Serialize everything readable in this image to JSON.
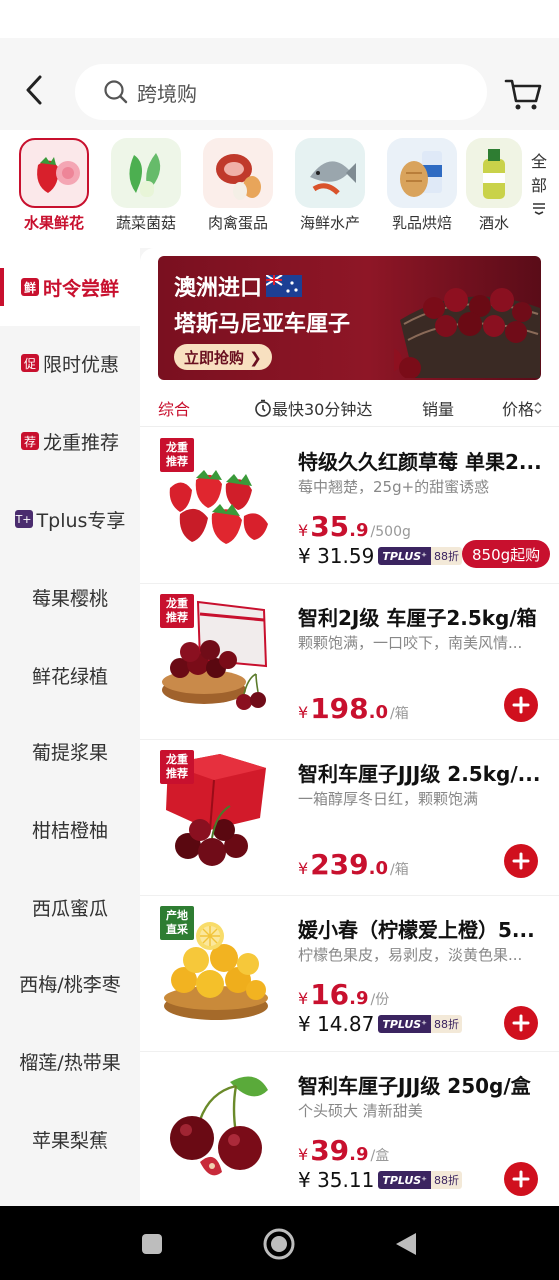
{
  "search": {
    "text": "跨境购"
  },
  "categories": [
    {
      "label": "水果鲜花",
      "icon": "strawberry-flower-image",
      "active": true
    },
    {
      "label": "蔬菜菌菇",
      "icon": "vegetable-image"
    },
    {
      "label": "肉禽蛋品",
      "icon": "meat-egg-image"
    },
    {
      "label": "海鲜水产",
      "icon": "seafood-image"
    },
    {
      "label": "乳品烘焙",
      "icon": "dairy-bakery-image"
    },
    {
      "label": "酒水",
      "icon": "drinks-image"
    }
  ],
  "all_button": {
    "line1": "全",
    "line2": "部"
  },
  "sidebar": {
    "items": [
      {
        "badge": "鲜",
        "label": "时令尝鲜",
        "active": true
      },
      {
        "badge": "促",
        "label": "限时优惠"
      },
      {
        "badge": "荐",
        "label": "龙重推荐"
      },
      {
        "badge": "T+",
        "label": "Tplus专享"
      },
      {
        "label": "莓果樱桃"
      },
      {
        "label": "鲜花绿植"
      },
      {
        "label": "葡提浆果"
      },
      {
        "label": "柑桔橙柚"
      },
      {
        "label": "西瓜蜜瓜"
      },
      {
        "label": "西梅/桃李枣"
      },
      {
        "label": "榴莲/热带果"
      },
      {
        "label": "苹果梨蕉"
      }
    ]
  },
  "banner": {
    "line1": "澳洲进口",
    "line2": "塔斯马尼亚车厘子",
    "button": "立即抢购 ❯"
  },
  "sort": {
    "comprehensive": "综合",
    "fastest": "最快30分钟达",
    "sales": "销量",
    "price": "价格"
  },
  "products": [
    {
      "tag": "龙重\n推荐",
      "title": "特级久久红颜草莓 单果2...",
      "subtitle": "莓中翘楚，25g+的甜蜜诱惑",
      "price_int": "35",
      "price_dec": ".9",
      "unit": "/500g",
      "plus_price": "¥ 31.59",
      "plus_label": "TPLUS⁺",
      "discount": "88折",
      "action": "850g起购"
    },
    {
      "tag": "龙重\n推荐",
      "title": "智利2J级 车厘子2.5kg/箱",
      "subtitle": "颗颗饱满，一口咬下，南美风情...",
      "price_int": "198",
      "price_dec": ".0",
      "unit": "/箱"
    },
    {
      "tag": "龙重\n推荐",
      "title": "智利车厘子JJJ级 2.5kg/...",
      "subtitle": "一箱醇厚冬日红，颗颗饱满",
      "price_int": "239",
      "price_dec": ".0",
      "unit": "/箱"
    },
    {
      "tag": "产地\n直采",
      "title": "媛小春（柠檬爱上橙）5...",
      "subtitle": "柠檬色果皮，易剥皮，淡黄色果...",
      "price_int": "16",
      "price_dec": ".9",
      "unit": "/份",
      "plus_price": "¥ 14.87",
      "plus_label": "TPLUS⁺",
      "discount": "88折"
    },
    {
      "title": "智利车厘子JJJ级 250g/盒",
      "subtitle": "个头硕大 清新甜美",
      "price_int": "39",
      "price_dec": ".9",
      "unit": "/盒",
      "plus_price": "¥ 35.11",
      "plus_label": "TPLUS⁺",
      "discount": "88折"
    }
  ],
  "currency": "¥",
  "colors": {
    "accent": "#c8102e",
    "tplus": "#3b2460"
  }
}
